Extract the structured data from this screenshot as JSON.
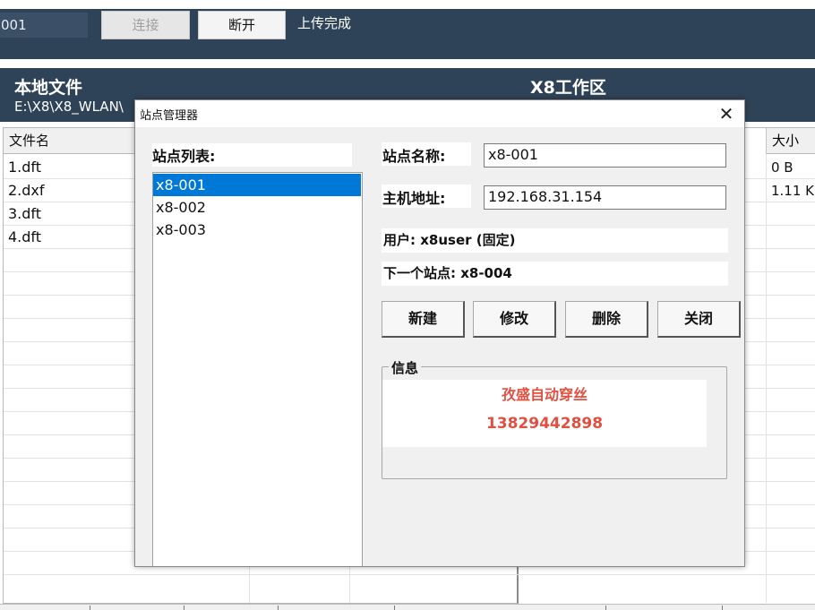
{
  "toolbar": {
    "site_value": "001",
    "connect_label": "连接",
    "disconnect_label": "断开",
    "status": "上传完成"
  },
  "local_panel": {
    "title": "本地文件",
    "path": "E:\\X8\\X8_WLAN\\",
    "column_name": "文件名",
    "files": [
      "1.dft",
      "2.dxf",
      "3.dft",
      "4.dft"
    ]
  },
  "remote_panel": {
    "title": "X8工作区",
    "column_size": "大小",
    "sizes": [
      "0 B",
      "1.11 K"
    ]
  },
  "dialog": {
    "title": "站点管理器",
    "close_glyph": "✕",
    "site_list_label": "站点列表:",
    "sites": [
      "x8-001",
      "x8-002",
      "x8-003"
    ],
    "selected_index": 0,
    "site_name_label": "站点名称:",
    "site_name_value": "x8-001",
    "host_label": "主机地址:",
    "host_value": "192.168.31.154",
    "user_line": "用户: x8user (固定)",
    "next_site_line": "下一个站点: x8-004",
    "buttons": {
      "new": "新建",
      "edit": "修改",
      "delete": "删除",
      "close": "关闭"
    },
    "info_legend": "信息",
    "company": "孜盛自动穿丝",
    "phone": "13829442898"
  },
  "colors": {
    "toolbar_bg": "#2f4358",
    "selection": "#0078d7",
    "info_text": "#e05040"
  }
}
